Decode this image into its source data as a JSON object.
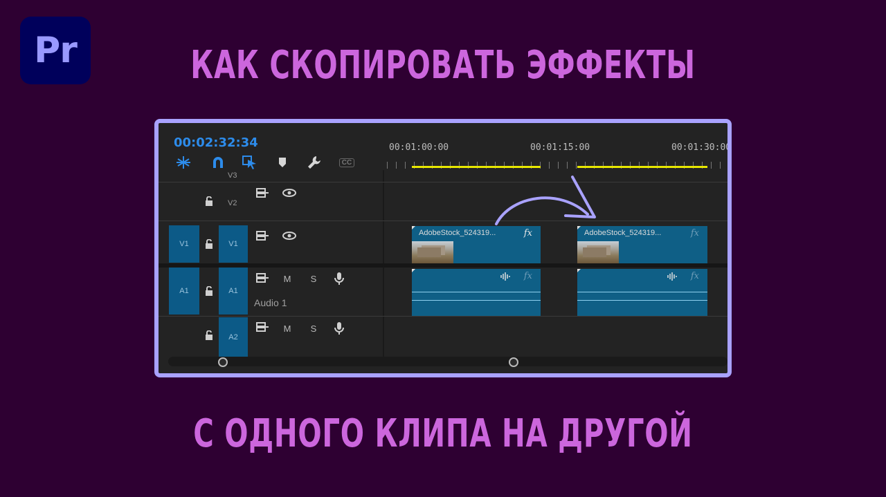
{
  "logo": {
    "text": "Pr"
  },
  "headline_top": "КАК СКОПИРОВАТЬ ЭФФЕКТЫ",
  "headline_bottom": "С ОДНОГО КЛИПА НА ДРУГОЙ",
  "timeline": {
    "timecode": "00:02:32:34",
    "tools": [
      "insert-snap-icon",
      "magnet-icon",
      "linked-selection-icon",
      "marker-icon",
      "wrench-icon",
      "captions-icon"
    ],
    "captions_label": "CC",
    "ruler": [
      "00:01:00:00",
      "00:01:15:00",
      "00:01:30:00"
    ],
    "tracks": {
      "v3": "V3",
      "v2": "V2",
      "v1": "V1",
      "a1": "A1",
      "a2": "A2",
      "v1_source": "V1",
      "a1_source": "A1"
    },
    "mute_label": "M",
    "solo_label": "S",
    "audio_track_name": "Audio 1",
    "clips": [
      {
        "name": "AdobeStock_524319...",
        "fx": "fx"
      },
      {
        "name": "AdobeStock_524319...",
        "fx": "fx"
      }
    ],
    "audio_fx": "fx"
  },
  "colors": {
    "background": "#2e0032",
    "headline": "#cc66dd",
    "panel_border": "#a9a2ff",
    "timecode": "#2d8ceb",
    "clip": "#0f5f86",
    "workarea": "#e8e800",
    "arrow": "#a9a2ff"
  }
}
